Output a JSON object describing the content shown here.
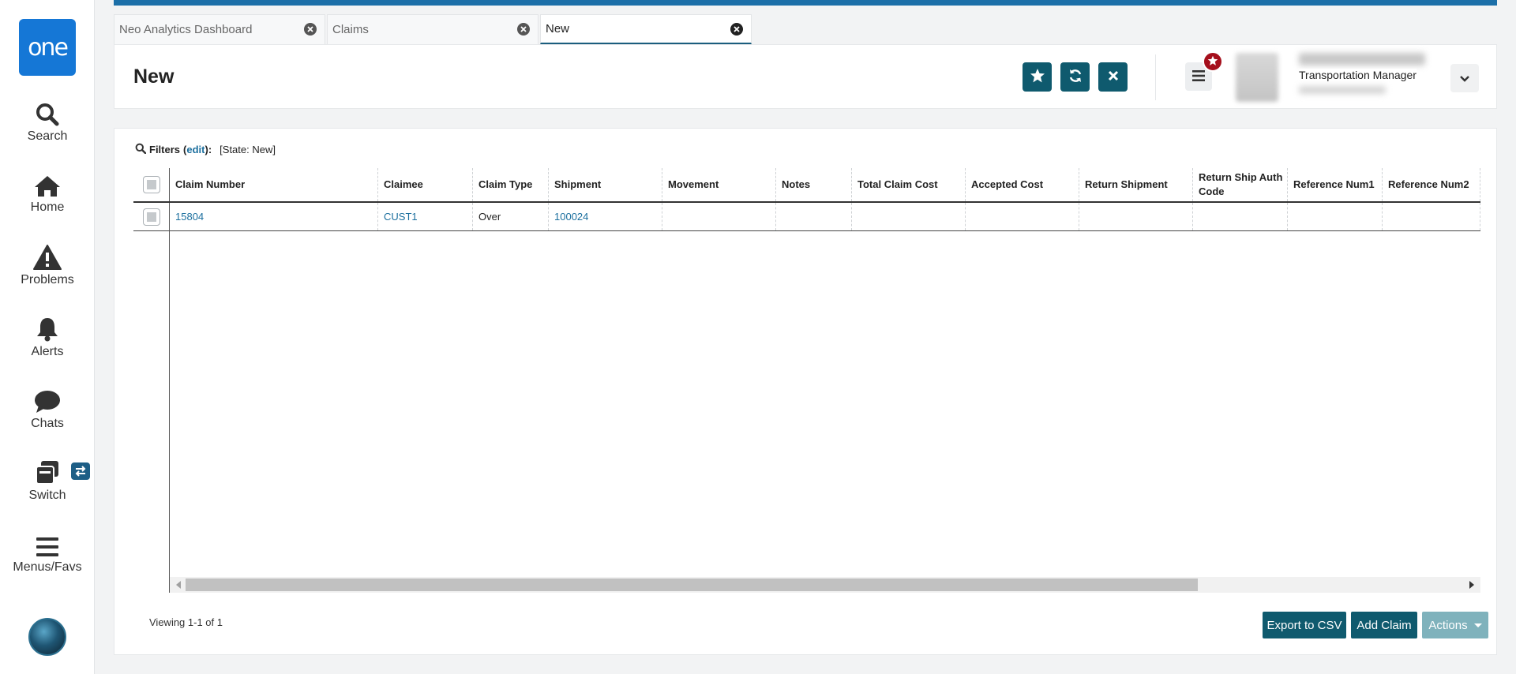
{
  "nav": {
    "logo": "one",
    "items": [
      {
        "label": "Search",
        "icon": "search-icon"
      },
      {
        "label": "Home",
        "icon": "home-icon"
      },
      {
        "label": "Problems",
        "icon": "warning-icon"
      },
      {
        "label": "Alerts",
        "icon": "bell-icon"
      },
      {
        "label": "Chats",
        "icon": "chat-bubble-icon"
      },
      {
        "label": "Switch",
        "icon": "switch-windows-icon"
      },
      {
        "label": "Menus/Favs",
        "icon": "hamburger-menu-icon"
      }
    ]
  },
  "tabs": [
    {
      "label": "Neo Analytics Dashboard",
      "active": false
    },
    {
      "label": "Claims",
      "active": false
    },
    {
      "label": "New",
      "active": true
    }
  ],
  "header": {
    "title": "New",
    "buttons": [
      "star-icon",
      "refresh-icon",
      "close-icon"
    ],
    "profile_role": "Transportation Manager"
  },
  "filters": {
    "label": "Filters",
    "edit_prefix": "(",
    "edit": "edit",
    "edit_suffix": "):",
    "state": "[State: New]"
  },
  "table": {
    "columns": [
      "Claim Number",
      "Claimee",
      "Claim Type",
      "Shipment",
      "Movement",
      "Notes",
      "Total Claim Cost",
      "Accepted Cost",
      "Return Shipment",
      "Return Ship Auth Code",
      "Reference Num1",
      "Reference Num2"
    ],
    "rows": [
      [
        "15804",
        "CUST1",
        "Over",
        "100024",
        "",
        "",
        "",
        "",
        "",
        "",
        "",
        ""
      ]
    ]
  },
  "footer": {
    "viewing": "Viewing 1-1 of 1",
    "export": "Export to CSV",
    "add": "Add Claim",
    "actions": "Actions"
  },
  "colors": {
    "brand": "#1577d6",
    "primary_button": "#0f5a6e",
    "link": "#1b6f9e",
    "notification": "#a50f1c"
  }
}
